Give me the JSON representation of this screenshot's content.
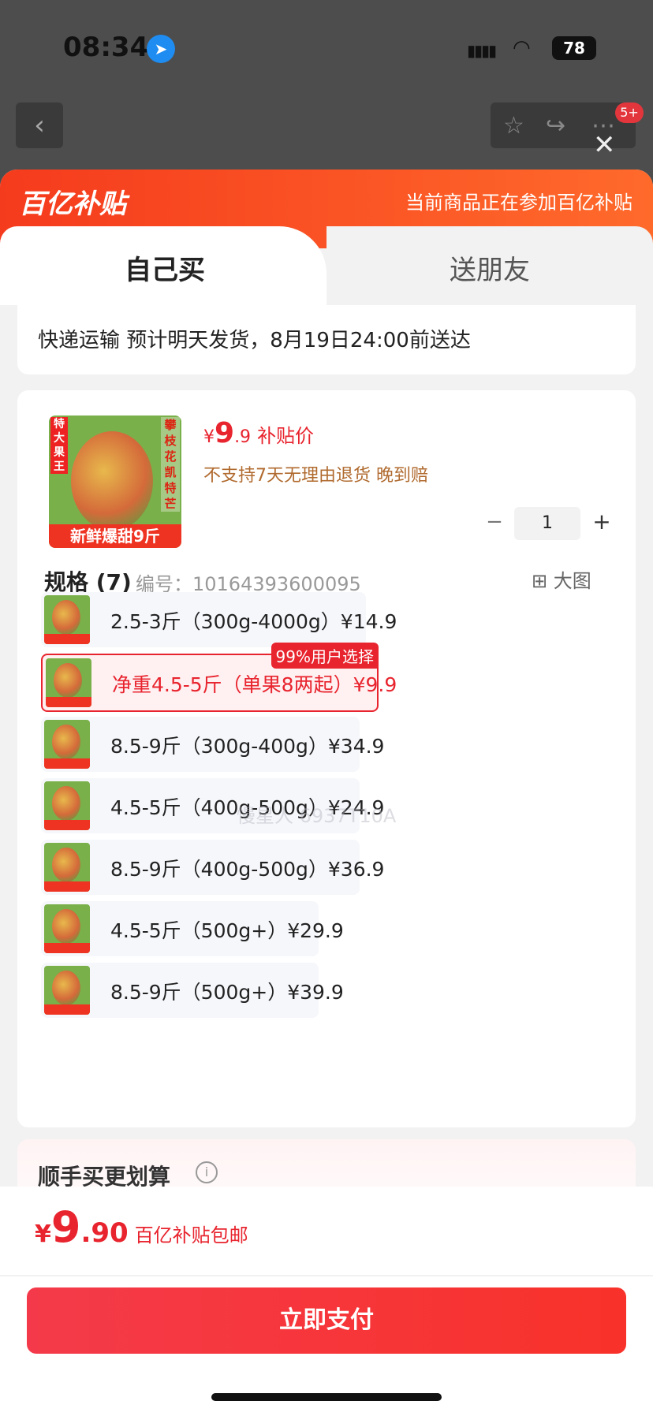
{
  "status_bar": {
    "time": "08:34",
    "battery": "78",
    "location_icon": "location-arrow-icon",
    "signal_icon": "cellular-signal-icon",
    "wifi_icon": "wifi-icon"
  },
  "top_nav": {
    "back_icon": "chevron-left-icon",
    "star_icon": "star-icon",
    "share_icon": "share-icon",
    "more_icon": "more-dots-icon",
    "badge": "5+"
  },
  "close_icon": "close-icon",
  "banner": {
    "logo": "百亿补贴",
    "note": "当前商品正在参加百亿补贴"
  },
  "tabs": [
    {
      "label": "自己买",
      "active": true
    },
    {
      "label": "送朋友",
      "active": false
    }
  ],
  "shipping": {
    "text": "快递运输 预计明天发货，8月19日24:00前送达"
  },
  "product": {
    "image_labels": {
      "left": "特大果王",
      "right": "攀枝花凯特芒",
      "bottom": "新鲜爆甜9斤"
    },
    "price": {
      "currency": "¥",
      "integer": "9",
      "decimal": ".9",
      "label": "补贴价"
    },
    "policy": "不支持7天无理由退货   晚到赔",
    "quantity": {
      "minus": "−",
      "value": "1",
      "plus": "+"
    }
  },
  "spec": {
    "heading": "规格 (7)",
    "code": "编号：10164393600095",
    "big_picture_label": "大图",
    "big_picture_icon": "grid-icon",
    "options": [
      {
        "text": "2.5-3斤（300g-4000g）¥14.9",
        "selected": false
      },
      {
        "text": "净重4.5-5斤（单果8两起）¥9.9",
        "selected": true,
        "badge": "99%用户选择"
      },
      {
        "text": "8.5-9斤（300g-400g）¥34.9",
        "selected": false
      },
      {
        "text": "4.5-5斤（400g-500g）¥24.9",
        "selected": false
      },
      {
        "text": "8.5-9斤（400g-500g）¥36.9",
        "selected": false
      },
      {
        "text": "4.5-5斤（500g+）¥29.9",
        "selected": false
      },
      {
        "text": "8.5-9斤（500g+）¥39.9",
        "selected": false
      }
    ],
    "watermark": "慢星人 6937T10A"
  },
  "extra": {
    "title": "顺手买更划算",
    "info_icon": "info-icon"
  },
  "footer": {
    "total": {
      "currency": "¥",
      "integer": "9",
      "decimal": ".90",
      "label": "百亿补贴包邮"
    },
    "pay_button": "立即支付"
  },
  "colors": {
    "accent": "#e8242e",
    "banner": "#f53b1d",
    "policy": "#b06a2e"
  }
}
